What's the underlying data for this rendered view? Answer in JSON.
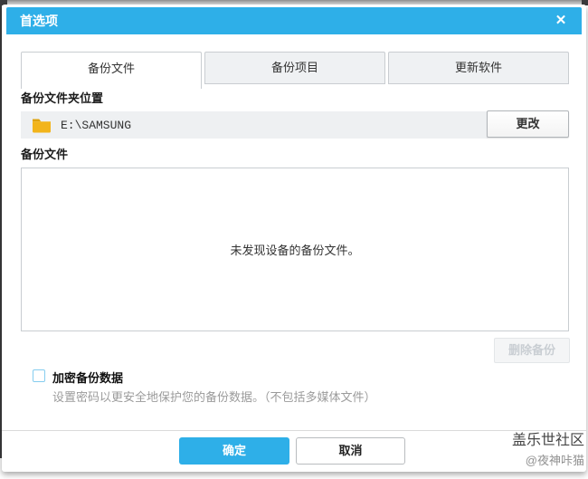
{
  "window": {
    "title": "首选项",
    "close_glyph": "✕"
  },
  "tabs": [
    {
      "label": "备份文件",
      "active": true
    },
    {
      "label": "备份项目",
      "active": false
    },
    {
      "label": "更新软件",
      "active": false
    }
  ],
  "backup_location": {
    "section_label": "备份文件夹位置",
    "path": "E:\\SAMSUNG",
    "change_button": "更改"
  },
  "backup_files": {
    "section_label": "备份文件",
    "empty_message": "未发现设备的备份文件。",
    "delete_button": "删除备份"
  },
  "encrypt": {
    "label": "加密备份数据",
    "description": "设置密码以更安全地保护您的备份数据。（不包括多媒体文件）",
    "checked": false
  },
  "footer": {
    "ok_button": "确定",
    "cancel_button": "取消"
  },
  "watermark": {
    "line1": "盖乐世社区",
    "line2": "@夜神咔猫"
  },
  "colors": {
    "accent": "#2eafe8",
    "checkbox_border": "#85cdef",
    "folder_yellow": "#f2b41b"
  }
}
